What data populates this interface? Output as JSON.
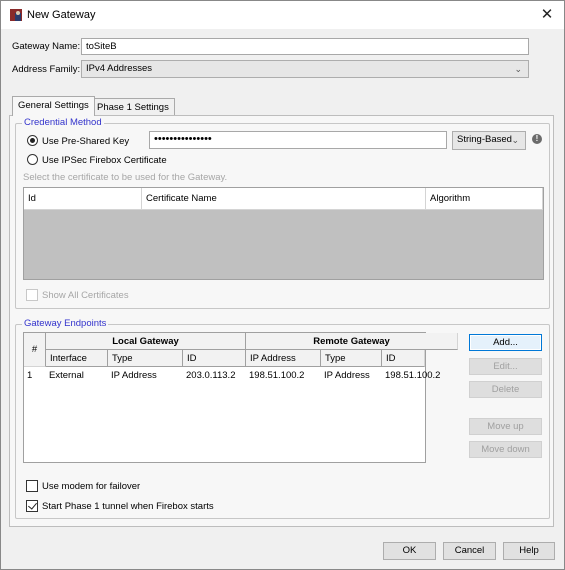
{
  "window": {
    "title": "New Gateway",
    "app_icon": "firebox-app-icon",
    "close_icon": "close-icon"
  },
  "form": {
    "gateway_name_label": "Gateway Name:",
    "gateway_name_value": "toSiteB",
    "address_family_label": "Address Family:",
    "address_family_value": "IPv4 Addresses"
  },
  "tabs": [
    {
      "label": "General Settings",
      "active": true
    },
    {
      "label": "Phase 1 Settings",
      "active": false
    }
  ],
  "credential": {
    "group_title": "Credential Method",
    "psk_label": "Use Pre-Shared Key",
    "psk_selected": true,
    "psk_value": "•••••••••••••••",
    "psk_type": "String-Based",
    "cert_label": "Use IPSec Firebox Certificate",
    "cert_selected": false,
    "cert_hint": "Select the certificate to be used for the Gateway.",
    "cert_table_headers": [
      "Id",
      "Certificate Name",
      "Algorithm"
    ],
    "show_all_label": "Show All Certificates",
    "show_all_checked": false
  },
  "endpoints": {
    "group_title": "Gateway Endpoints",
    "header_num": "#",
    "header_local": "Local Gateway",
    "header_remote": "Remote Gateway",
    "columns": [
      "Interface",
      "Type",
      "ID",
      "IP Address",
      "Type",
      "ID"
    ],
    "rows": [
      {
        "num": "1",
        "interface": "External",
        "local_type": "IP Address",
        "local_id": "203.0.113.2",
        "remote_ip": "198.51.100.2",
        "remote_type": "IP Address",
        "remote_id": "198.51.100.2"
      }
    ],
    "buttons": {
      "add": "Add...",
      "edit": "Edit...",
      "delete": "Delete",
      "move_up": "Move up",
      "move_down": "Move down"
    }
  },
  "options": {
    "modem_label": "Use modem for failover",
    "modem_checked": false,
    "start_tunnel_label": "Start Phase 1 tunnel when Firebox starts",
    "start_tunnel_checked": true
  },
  "footer": {
    "ok": "OK",
    "cancel": "Cancel",
    "help": "Help"
  }
}
